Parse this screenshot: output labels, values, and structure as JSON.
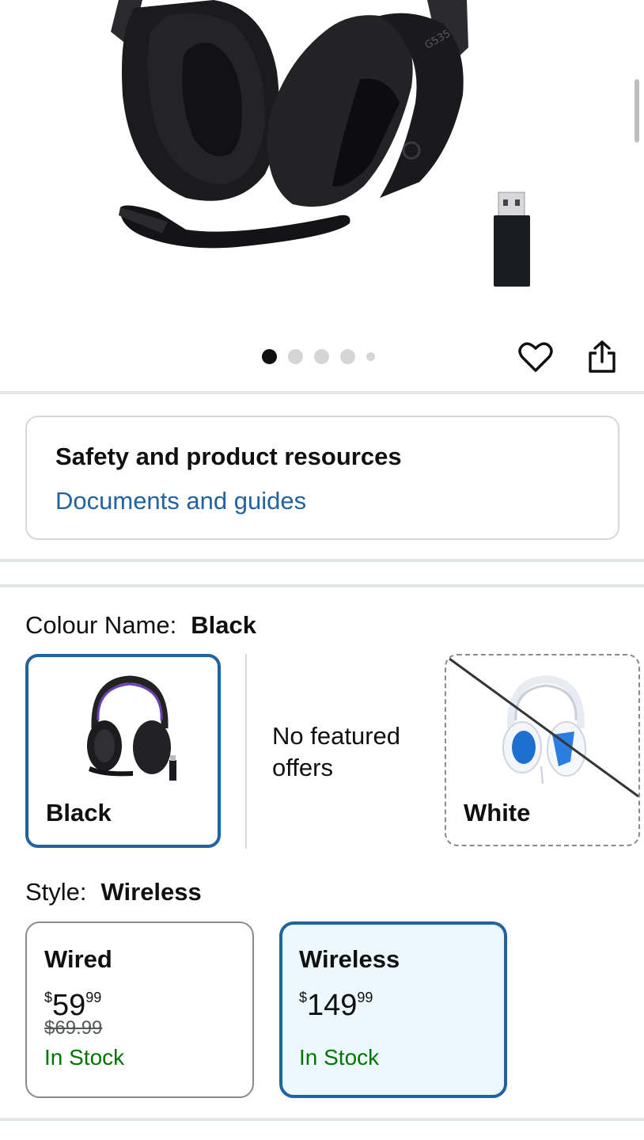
{
  "product": {
    "image_alt": "Logitech G535 wireless gaming headset with USB receiver",
    "headset_model_text": "G535"
  },
  "carousel": {
    "total_dots": 5,
    "active_index": 0
  },
  "actions": {
    "wishlist_icon": "heart-icon",
    "share_icon": "share-icon"
  },
  "safety": {
    "title": "Safety and product resources",
    "link": "Documents and guides"
  },
  "colour": {
    "label": "Colour Name:",
    "selected": "Black",
    "options": [
      {
        "name": "Black",
        "state": "selected"
      },
      {
        "name": "White",
        "state": "unavailable"
      }
    ],
    "no_offers_text": "No featured offers"
  },
  "style": {
    "label": "Style:",
    "selected": "Wireless",
    "options": [
      {
        "name": "Wired",
        "price_symbol": "$",
        "price_whole": "59",
        "price_fraction": "99",
        "was_price": "$69.99",
        "availability": "In Stock"
      },
      {
        "name": "Wireless",
        "price_symbol": "$",
        "price_whole": "149",
        "price_fraction": "99",
        "was_price": "",
        "availability": "In Stock"
      }
    ]
  },
  "colors": {
    "accent_blue": "#2162a1",
    "selected_bg": "#edf8fe",
    "stock_green": "#007600"
  }
}
